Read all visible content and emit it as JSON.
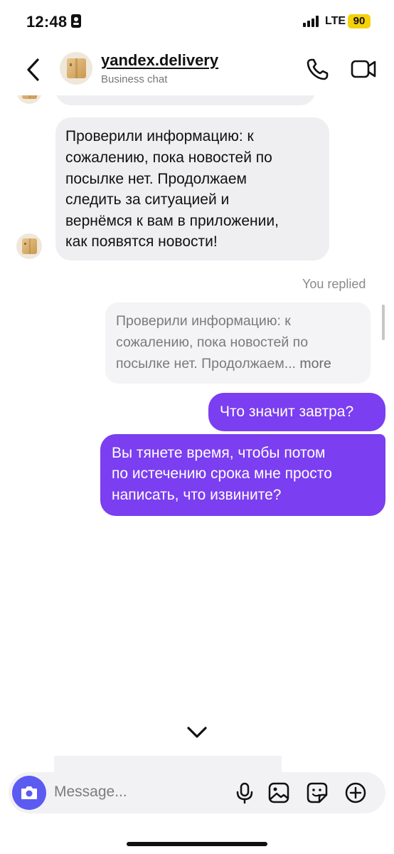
{
  "status": {
    "time": "12:48",
    "network": "LTE",
    "battery": "90"
  },
  "header": {
    "title": "yandex.delivery",
    "subtitle": "Business chat"
  },
  "messages": {
    "incoming_1": {
      "lines": [
        "Проверили информацию: к",
        "сожалению, пока новостей по",
        "посылке нет. Продолжаем",
        "следить за ситуацией и",
        "вернёмся к вам в приложении,",
        "как появятся новости!"
      ]
    },
    "reply_label": "You replied",
    "quoted": {
      "lines": [
        "Проверили информацию: к",
        "сожалению, пока новостей по"
      ],
      "last_line": "посылке нет. Продолжаем...",
      "more": "more"
    },
    "outgoing_1": "Что значит завтра?",
    "outgoing_2": {
      "lines": [
        "Вы тянете время, чтобы потом",
        "по истечению срока мне просто",
        "написать, что извините?"
      ]
    }
  },
  "composer": {
    "placeholder": "Message..."
  },
  "icons": {
    "back": "chevron-left-icon",
    "call": "phone-icon",
    "video": "video-camera-icon",
    "scroll_down": "chevron-down-icon",
    "camera": "camera-icon",
    "mic": "microphone-icon",
    "gallery": "image-icon",
    "sticker": "sticker-icon",
    "add": "plus-circle-icon"
  },
  "colors": {
    "outgoing_bubble": "#7b3ef0",
    "incoming_bubble": "#efeff2",
    "camera_button": "#5b5bf2",
    "battery": "#f5d10a"
  }
}
